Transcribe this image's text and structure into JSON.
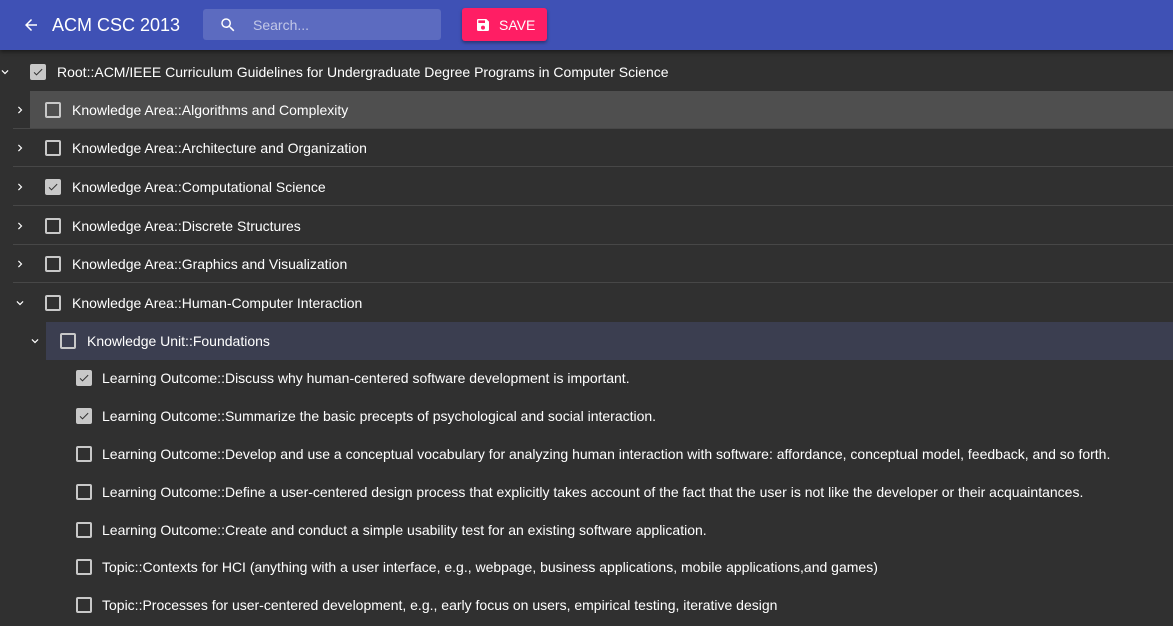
{
  "header": {
    "back_icon": "arrow-left-icon",
    "title": "ACM CSC 2013",
    "search": {
      "icon": "search-icon",
      "placeholder": "Search...",
      "value": ""
    },
    "save": {
      "icon": "floppy-disk-icon",
      "label": "SAVE"
    },
    "colors": {
      "toolbar": "#3f51b5",
      "search_bg": "#5c6bc0",
      "save_bg": "#ff1e64",
      "background": "#303030"
    }
  },
  "tree": {
    "root": {
      "label": "Root::ACM/IEEE Curriculum Guidelines for Undergraduate Degree Programs in Computer Science",
      "checked": true,
      "expanded": true
    },
    "knowledge_areas": [
      {
        "label": "Knowledge Area::Algorithms and Complexity",
        "checked": false,
        "expanded": false,
        "highlighted": true
      },
      {
        "label": "Knowledge Area::Architecture and Organization",
        "checked": false,
        "expanded": false
      },
      {
        "label": "Knowledge Area::Computational Science",
        "checked": true,
        "expanded": false
      },
      {
        "label": "Knowledge Area::Discrete Structures",
        "checked": false,
        "expanded": false
      },
      {
        "label": "Knowledge Area::Graphics and Visualization",
        "checked": false,
        "expanded": false
      },
      {
        "label": "Knowledge Area::Human-Computer Interaction",
        "checked": false,
        "expanded": true
      }
    ],
    "knowledge_unit": {
      "label": "Knowledge Unit::Foundations",
      "checked": false,
      "expanded": true
    },
    "leaves": [
      {
        "label": "Learning Outcome::Discuss why human-centered software development is important.",
        "checked": true
      },
      {
        "label": "Learning Outcome::Summarize the basic precepts of psychological and social interaction.",
        "checked": true
      },
      {
        "label": "Learning Outcome::Develop and use a conceptual vocabulary for analyzing human interaction with software: affordance, conceptual model, feedback, and so forth.",
        "checked": false
      },
      {
        "label": "Learning Outcome::Define a user-centered design process that explicitly takes account of the fact that the user is not like the developer or their acquaintances.",
        "checked": false
      },
      {
        "label": "Learning Outcome::Create and conduct a simple usability test for an existing software application.",
        "checked": false
      },
      {
        "label": "Topic::Contexts for HCI (anything with a user interface, e.g., webpage, business applications, mobile applications,and games)",
        "checked": false
      },
      {
        "label": "Topic::Processes for user-centered development, e.g., early focus on users, empirical testing, iterative design",
        "checked": false
      }
    ],
    "icons": {
      "collapsed": "chevron-right-icon",
      "expanded": "chevron-down-icon",
      "checkbox_checked": "checkbox-checked-icon",
      "checkbox_unchecked": "checkbox-unchecked-icon"
    },
    "colors": {
      "hover_row": "#4f4f4f",
      "unit_row": "#3b3e50",
      "checkbox": "#c8c8c8",
      "separator": "#474747"
    }
  }
}
